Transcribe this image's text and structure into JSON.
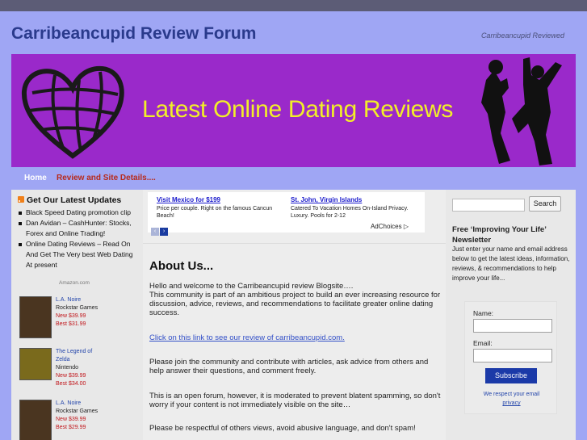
{
  "header": {
    "site_title": "Carribeancupid Review Forum",
    "tagline": "Carribeancupid Reviewed",
    "banner_text": "Latest Online Dating Reviews"
  },
  "nav": {
    "home": "Home",
    "review": "Review and Site Details...."
  },
  "left_sidebar": {
    "updates_title": "Get Our Latest Updates",
    "updates": [
      "Black Speed Dating promotion clip",
      "Dan Avidan – CashHunter: Stocks, Forex and Online Trading!",
      "Online Dating Reviews – Read On And Get The Very best Web Dating At present"
    ],
    "amazon_label": "Amazon.com",
    "products": [
      {
        "title": "L.A. Noire",
        "maker": "Rockstar Games",
        "new": "New $39.99",
        "best": "Best $31.99"
      },
      {
        "title": "The Legend of Zelda",
        "maker": "Nintendo",
        "new": "New $39.99",
        "best": "Best $34.00"
      },
      {
        "title": "L.A. Noire",
        "maker": "Rockstar Games",
        "new": "New $39.99",
        "best": "Best $29.99"
      }
    ]
  },
  "ads": {
    "ad1_title": "Visit Mexico for $199",
    "ad1_text": "Price per couple. Right on the famous Cancun Beach!",
    "ad2_title": "St. John, Virgin Islands",
    "ad2_text": "Catered To Vacation Homes On-Island Privacy. Luxury. Pools for 2-12",
    "prev": "‹",
    "next": "›",
    "adchoices": "AdChoices ▷"
  },
  "main": {
    "about_title": "About Us...",
    "p1_line1": "Hello and welcome to the Carribeancupid review Blogsite….",
    "p1_line2": "This community is part of an ambitious project to build an ever increasing resource for discussion, advice, reviews, and recommendations to facilitate greater online dating success.",
    "link_text": "Click on this link to see our review of carribeancupid.com.",
    "p2": "Please join the community and contribute with articles, ask advice from others and help answer their questions, and comment freely.",
    "p3": "This is an open forum, however, it is moderated to prevent blatent spamming, so don't worry if your content is not immediately visible on the site…",
    "p4": "Please be respectful of others views, avoid abusive language, and don't spam!"
  },
  "right_sidebar": {
    "search_button": "Search",
    "newsletter_title": "Free ‘Improving Your Life’ Newsletter",
    "newsletter_text": "Just enter your name and email address below to get the latest ideas, information, reviews, & recommendations to help improve your life...",
    "name_label": "Name:",
    "email_label": "Email:",
    "subscribe": "Subscribe",
    "respect_note": "We respect your email",
    "privacy": "privacy"
  },
  "colors": {
    "page_bg": "#9fa6f4",
    "banner_bg": "#9a29ca",
    "banner_text": "#f2ef28",
    "title": "#2a3a8c",
    "nav_review": "#b72a1b",
    "subscribe_bg": "#1b3aa8"
  }
}
